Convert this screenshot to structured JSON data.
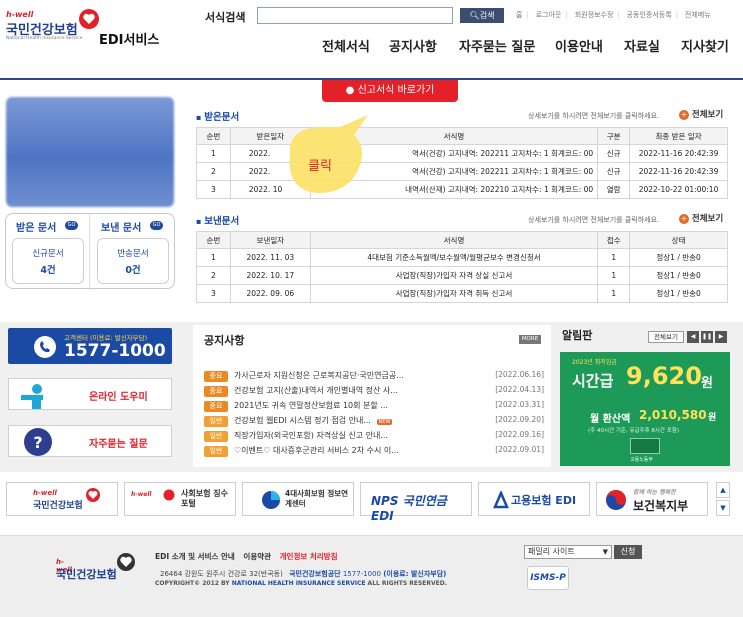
{
  "header": {
    "logo_small": "h-well",
    "logo_main": "국민건강보험",
    "logo_sub": "National Health Insurance Service",
    "service_name": "EDI서비스",
    "search_label": "서식검색",
    "search_button": "검색",
    "search_value": "",
    "util_links": [
      "홈",
      "로그아웃",
      "회원정보수정",
      "공동인증서등록",
      "전체메뉴"
    ],
    "gnb": [
      "전체서식",
      "공지사항",
      "자주묻는 질문",
      "이용안내",
      "자료실",
      "지사찾기"
    ]
  },
  "shortcut_banner": "신고서식 바로가기",
  "annotation_text": "클릭",
  "received": {
    "title": "받은문서",
    "help": "상세보기를 하시려면 전체보기를 클릭하세요.",
    "more": "전체보기",
    "headers": [
      "순번",
      "받은일자",
      "서식명",
      "구분",
      "최종 받은 일자"
    ],
    "rows": [
      [
        "1",
        "2022.",
        "역서(건강) 고지내역: 202211 고지차수: 1 회계코드: 00",
        "신규",
        "2022-11-16 20:42:39"
      ],
      [
        "2",
        "2022.",
        "역서(건강) 고지내역: 202211 고지차수: 1 회계코드: 00",
        "신규",
        "2022-11-16 20:42:39"
      ],
      [
        "3",
        "2022. 10",
        "내역서(산재) 고지내역: 202210 고지차수: 1 회계코드: 00",
        "열람",
        "2022-10-22 01:00:10"
      ]
    ]
  },
  "sent": {
    "title": "보낸문서",
    "help": "상세보기를 하시려면 전체보기를 클릭하세요.",
    "more": "전체보기",
    "headers": [
      "순번",
      "보낸일자",
      "서식명",
      "접수",
      "상태"
    ],
    "rows": [
      [
        "1",
        "2022. 11. 03",
        "4대보험 기준소득월액/보수월액/월평균보수 변경신청서",
        "1",
        "정상1 / 반송0"
      ],
      [
        "2",
        "2022. 10. 17",
        "사업장(직장)가입자 자격 상실 신고서",
        "1",
        "정상1 / 반송0"
      ],
      [
        "3",
        "2022. 09. 06",
        "사업장(직장)가입자 자격 취득 신고서",
        "1",
        "정상1 / 반송0"
      ]
    ]
  },
  "doc_box": {
    "recv_tab": "받은 문서",
    "sent_tab": "보낸 문서",
    "go": "GO",
    "new_label": "신규문서",
    "new_count": "4건",
    "return_label": "반송문서",
    "return_count": "0건"
  },
  "left_lower": {
    "callcenter_label": "고객센터 (이용료: 발신자부담)",
    "callcenter_number": "1577-1000",
    "online_help": "온라인 도우미",
    "faq": "자주묻는 질문"
  },
  "notice": {
    "title": "공지사항",
    "more": "MORE",
    "items": [
      {
        "badge": "중요",
        "text": "가사근로자 지원신청은 근로복지공단·국민연금공...",
        "date": "[2022.06.16]",
        "is_new": false
      },
      {
        "badge": "중요",
        "text": "건강보험 고지(산출)내역서 개인별내역 정산 사...",
        "date": "[2022.04.13]",
        "is_new": false
      },
      {
        "badge": "중요",
        "text": "2021년도 귀속 연말정산보험료 10회 분할 ...",
        "date": "[2022.03.31]",
        "is_new": false
      },
      {
        "badge": "일반",
        "text": "건강보험 웹EDI 시스템 정기 점검 안내...",
        "date": "[2022.09.20]",
        "is_new": true
      },
      {
        "badge": "일반",
        "text": "직장가입자(외국인포함) 자격상실 신고 안내...",
        "date": "[2022.09.16]",
        "is_new": false
      },
      {
        "badge": "일반",
        "text": "♡이벤트♡ 대사증후군관리 서비스 2차 수시 이...",
        "date": "[2022.09.01]",
        "is_new": false
      }
    ],
    "new_badge": "NEW"
  },
  "alarm": {
    "title": "알림판",
    "view_all": "전체보기",
    "banner_top": "2023년 최저임금",
    "banner_label": "시간급",
    "banner_amount": "9,620",
    "banner_unit": "원",
    "banner_month_label": "월 환산액",
    "banner_month_amount": "2,010,580",
    "banner_month_unit": "원",
    "banner_note": "(주 40시간 기준, 유급주휴 8시간 포함)",
    "banner_org": "고용노동부"
  },
  "partners": [
    "국민건강보험",
    "사회보험 징수포털",
    "4대사회보험 정보연계센터",
    "NPS 국민연금 EDI",
    "고용보험 EDI",
    "보건복지부"
  ],
  "partners_sub": {
    "nhis_small": "h-well",
    "nps_small": "국민연금",
    "mohw_slogan": "함께 하는 행복한 "
  },
  "footer": {
    "menu": [
      "EDI 소개 및 서비스 안내",
      "이용약관",
      "개인정보 처리방침"
    ],
    "address": "26464 강원도 원주시 건강로 32(반곡동)",
    "org": "국민건강보험공단",
    "phone": "1577-1000",
    "phone_note": "(이용료: 발신자부담)",
    "copyright_prefix": "COPYRIGHT© 2012 BY",
    "copyright_org": "NATIONAL HEALTH INSURANCE SERVICE",
    "copyright_suffix": "ALL RIGHTS RESERVED.",
    "family_site": "패밀리 사이트",
    "family_go": "신청",
    "isms": "ISMS-P"
  },
  "colors": {
    "brand_blue": "#1d3f8f",
    "accent_red": "#e42128",
    "notice_orange": "#e98b25",
    "alarm_green": "#1d9a57"
  }
}
